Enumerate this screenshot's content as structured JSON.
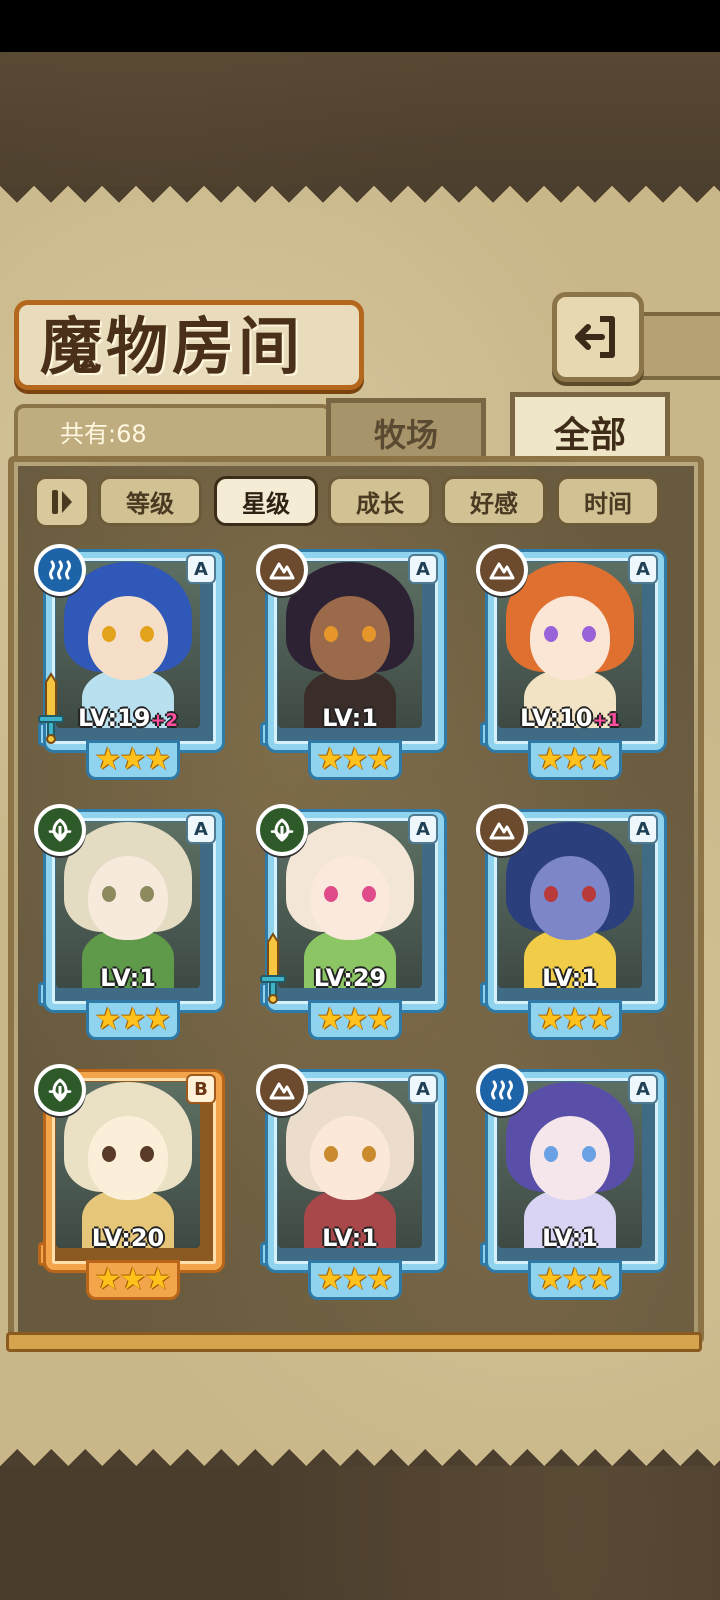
{
  "header": {
    "title": "魔物房间",
    "count_label": "共有:68"
  },
  "tabs": [
    {
      "label": "牧场",
      "active": false
    },
    {
      "label": "全部",
      "active": true
    }
  ],
  "sort": {
    "buttons": [
      {
        "label": "等级",
        "active": false
      },
      {
        "label": "星级",
        "active": true
      },
      {
        "label": "成长",
        "active": false
      },
      {
        "label": "好感",
        "active": false
      },
      {
        "label": "时间",
        "active": false
      }
    ]
  },
  "cards": [
    {
      "element": "water-icon",
      "rank": "A",
      "level": "LV:19",
      "bonus": "+2",
      "stars": 3,
      "equipped": true,
      "hair": "#2f58b8",
      "skin": "#f6dfc8",
      "eyes": "#e3a21b",
      "outfit": "#b8e0ef"
    },
    {
      "element": "earth-icon",
      "rank": "A",
      "level": "LV:1",
      "bonus": "",
      "stars": 3,
      "equipped": false,
      "hair": "#2d2234",
      "skin": "#9b6a4a",
      "eyes": "#e6962a",
      "outfit": "#3b2d2a"
    },
    {
      "element": "earth-icon",
      "rank": "A",
      "level": "LV:10",
      "bonus": "+1",
      "stars": 3,
      "equipped": false,
      "hair": "#e07030",
      "skin": "#fbe6d6",
      "eyes": "#9a62d8",
      "outfit": "#f1e3c3"
    },
    {
      "element": "plant-icon",
      "rank": "A",
      "level": "LV:1",
      "bonus": "",
      "stars": 3,
      "equipped": false,
      "hair": "#e4dcc2",
      "skin": "#f7eadc",
      "eyes": "#8d8a5e",
      "outfit": "#5f9a4b"
    },
    {
      "element": "plant-icon",
      "rank": "A",
      "level": "LV:29",
      "bonus": "",
      "stars": 3,
      "equipped": true,
      "hair": "#f3e6d6",
      "skin": "#fbe9de",
      "eyes": "#e04b8a",
      "outfit": "#8cc564"
    },
    {
      "element": "earth-icon",
      "rank": "A",
      "level": "LV:1",
      "bonus": "",
      "stars": 3,
      "equipped": false,
      "hair": "#2b3f7d",
      "skin": "#7d86c9",
      "eyes": "#b83a3a",
      "outfit": "#f1cc48"
    },
    {
      "element": "plant-icon",
      "rank": "B",
      "level": "LV:20",
      "bonus": "",
      "stars": 3,
      "equipped": false,
      "hair": "#eae0c4",
      "skin": "#fbefd9",
      "eyes": "#5a3b2a",
      "outfit": "#e6c77a"
    },
    {
      "element": "earth-icon",
      "rank": "A",
      "level": "LV:1",
      "bonus": "",
      "stars": 3,
      "equipped": false,
      "hair": "#ebdccc",
      "skin": "#fbe8d8",
      "eyes": "#c98b2d",
      "outfit": "#a8484a"
    },
    {
      "element": "water-icon",
      "rank": "A",
      "level": "LV:1",
      "bonus": "",
      "stars": 3,
      "equipped": false,
      "hair": "#5a4fa8",
      "skin": "#f4e6ea",
      "eyes": "#6aa0e4",
      "outfit": "#d9d3f4"
    }
  ]
}
